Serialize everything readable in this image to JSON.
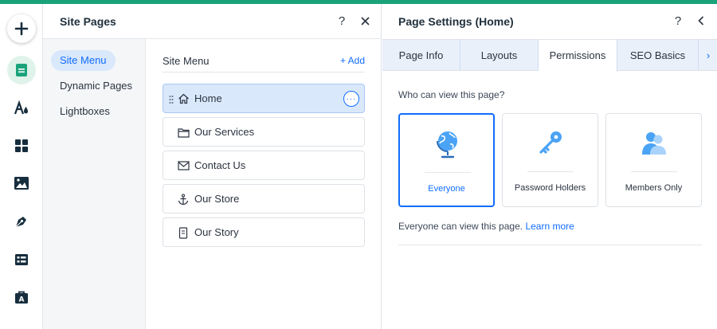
{
  "colors": {
    "accent": "#116dff",
    "topbar": "#1aa37a",
    "tabs_bg": "#e9f0fa",
    "selected_bg": "#d9e8fb"
  },
  "rail": [
    {
      "name": "add-icon"
    },
    {
      "name": "pages-icon"
    },
    {
      "name": "design-icon"
    },
    {
      "name": "apps-icon"
    },
    {
      "name": "media-icon"
    },
    {
      "name": "blog-icon"
    },
    {
      "name": "cms-icon"
    },
    {
      "name": "portfolio-icon"
    }
  ],
  "site_pages": {
    "title": "Site Pages",
    "help_icon": "question-icon",
    "close_icon": "close-icon",
    "nav": {
      "site_menu": "Site Menu",
      "dynamic_pages": "Dynamic Pages",
      "lightboxes": "Lightboxes"
    },
    "menu_label": "Site Menu",
    "add_label": "+ Add",
    "pages": [
      {
        "label": "Home",
        "icon": "home-icon",
        "selected": true
      },
      {
        "label": "Our Services",
        "icon": "folder-icon"
      },
      {
        "label": "Contact Us",
        "icon": "envelope-icon"
      },
      {
        "label": "Our Store",
        "icon": "anchor-icon"
      },
      {
        "label": "Our Story",
        "icon": "document-icon"
      }
    ],
    "more_label": "···"
  },
  "page_settings": {
    "title": "Page Settings (Home)",
    "help_icon": "question-icon",
    "back_icon": "chevron-left-icon",
    "tabs": [
      "Page Info",
      "Layouts",
      "Permissions",
      "SEO Basics"
    ],
    "active_tab": "Permissions",
    "tab_more": "›",
    "question": "Who can view this page?",
    "options": [
      {
        "label": "Everyone",
        "icon": "globe-icon",
        "selected": true
      },
      {
        "label": "Password Holders",
        "icon": "key-icon"
      },
      {
        "label": "Members Only",
        "icon": "members-icon"
      }
    ],
    "info_text": "Everyone can view this page.",
    "learn_more": "Learn more"
  }
}
